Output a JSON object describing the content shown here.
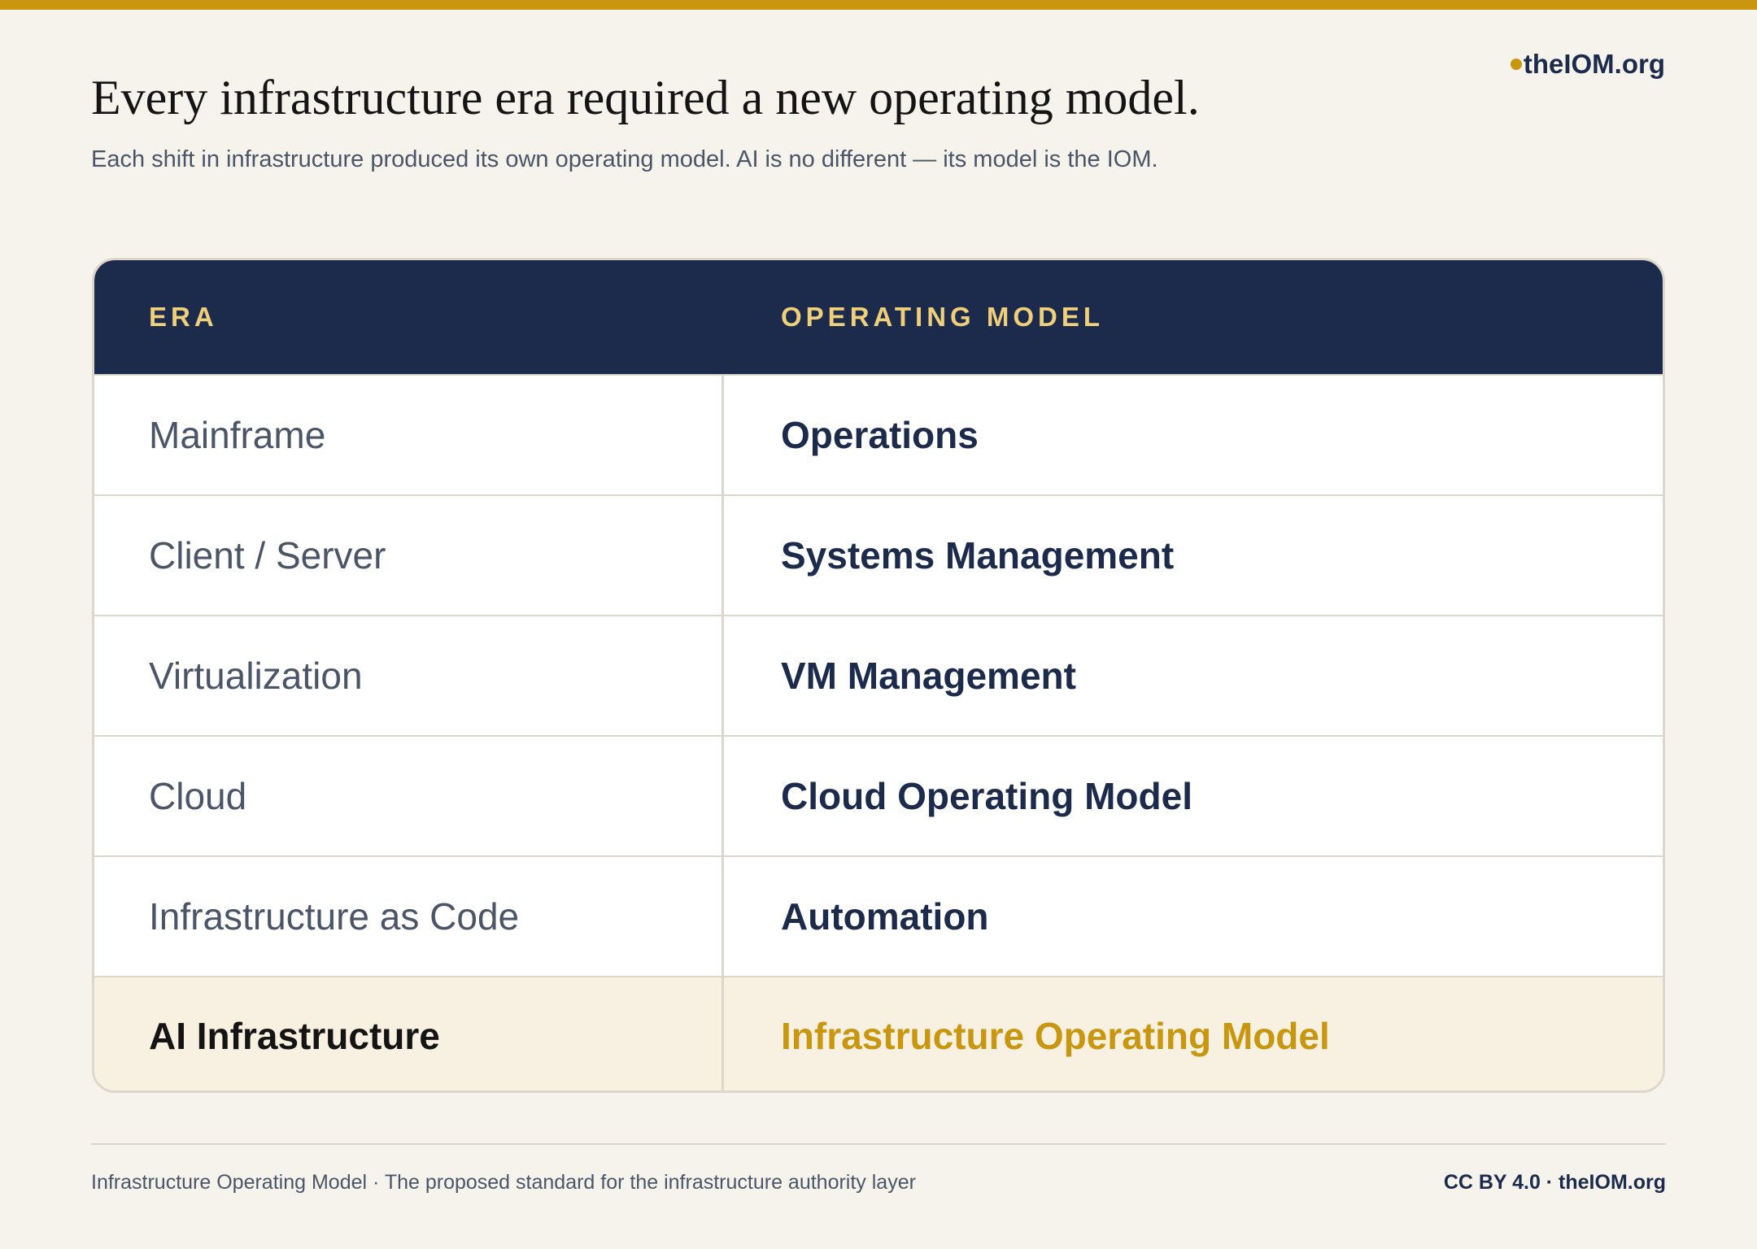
{
  "colors": {
    "accent": "#c8960f",
    "navy": "#1c2b4c",
    "background": "#f6f3ed",
    "header_text": "#f0cf7a",
    "highlight_row": "#f8f1e1"
  },
  "brand": {
    "icon": "dot-icon",
    "label": "theIOM.org"
  },
  "heading": {
    "title": "Every infrastructure era required a new operating model.",
    "subtitle": "Each shift in infrastructure produced its own operating model. AI is no different — its model is the IOM."
  },
  "table": {
    "columns": [
      "ERA",
      "OPERATING MODEL"
    ],
    "rows": [
      {
        "era": "Mainframe",
        "model": "Operations"
      },
      {
        "era": "Client / Server",
        "model": "Systems Management"
      },
      {
        "era": "Virtualization",
        "model": "VM Management"
      },
      {
        "era": "Cloud",
        "model": "Cloud Operating Model"
      },
      {
        "era": "Infrastructure as Code",
        "model": "Automation"
      },
      {
        "era": "AI Infrastructure",
        "model": "Infrastructure Operating Model"
      }
    ]
  },
  "footer": {
    "left": "Infrastructure Operating Model · The proposed standard for the infrastructure authority layer",
    "right": "CC BY 4.0 · theIOM.org"
  }
}
